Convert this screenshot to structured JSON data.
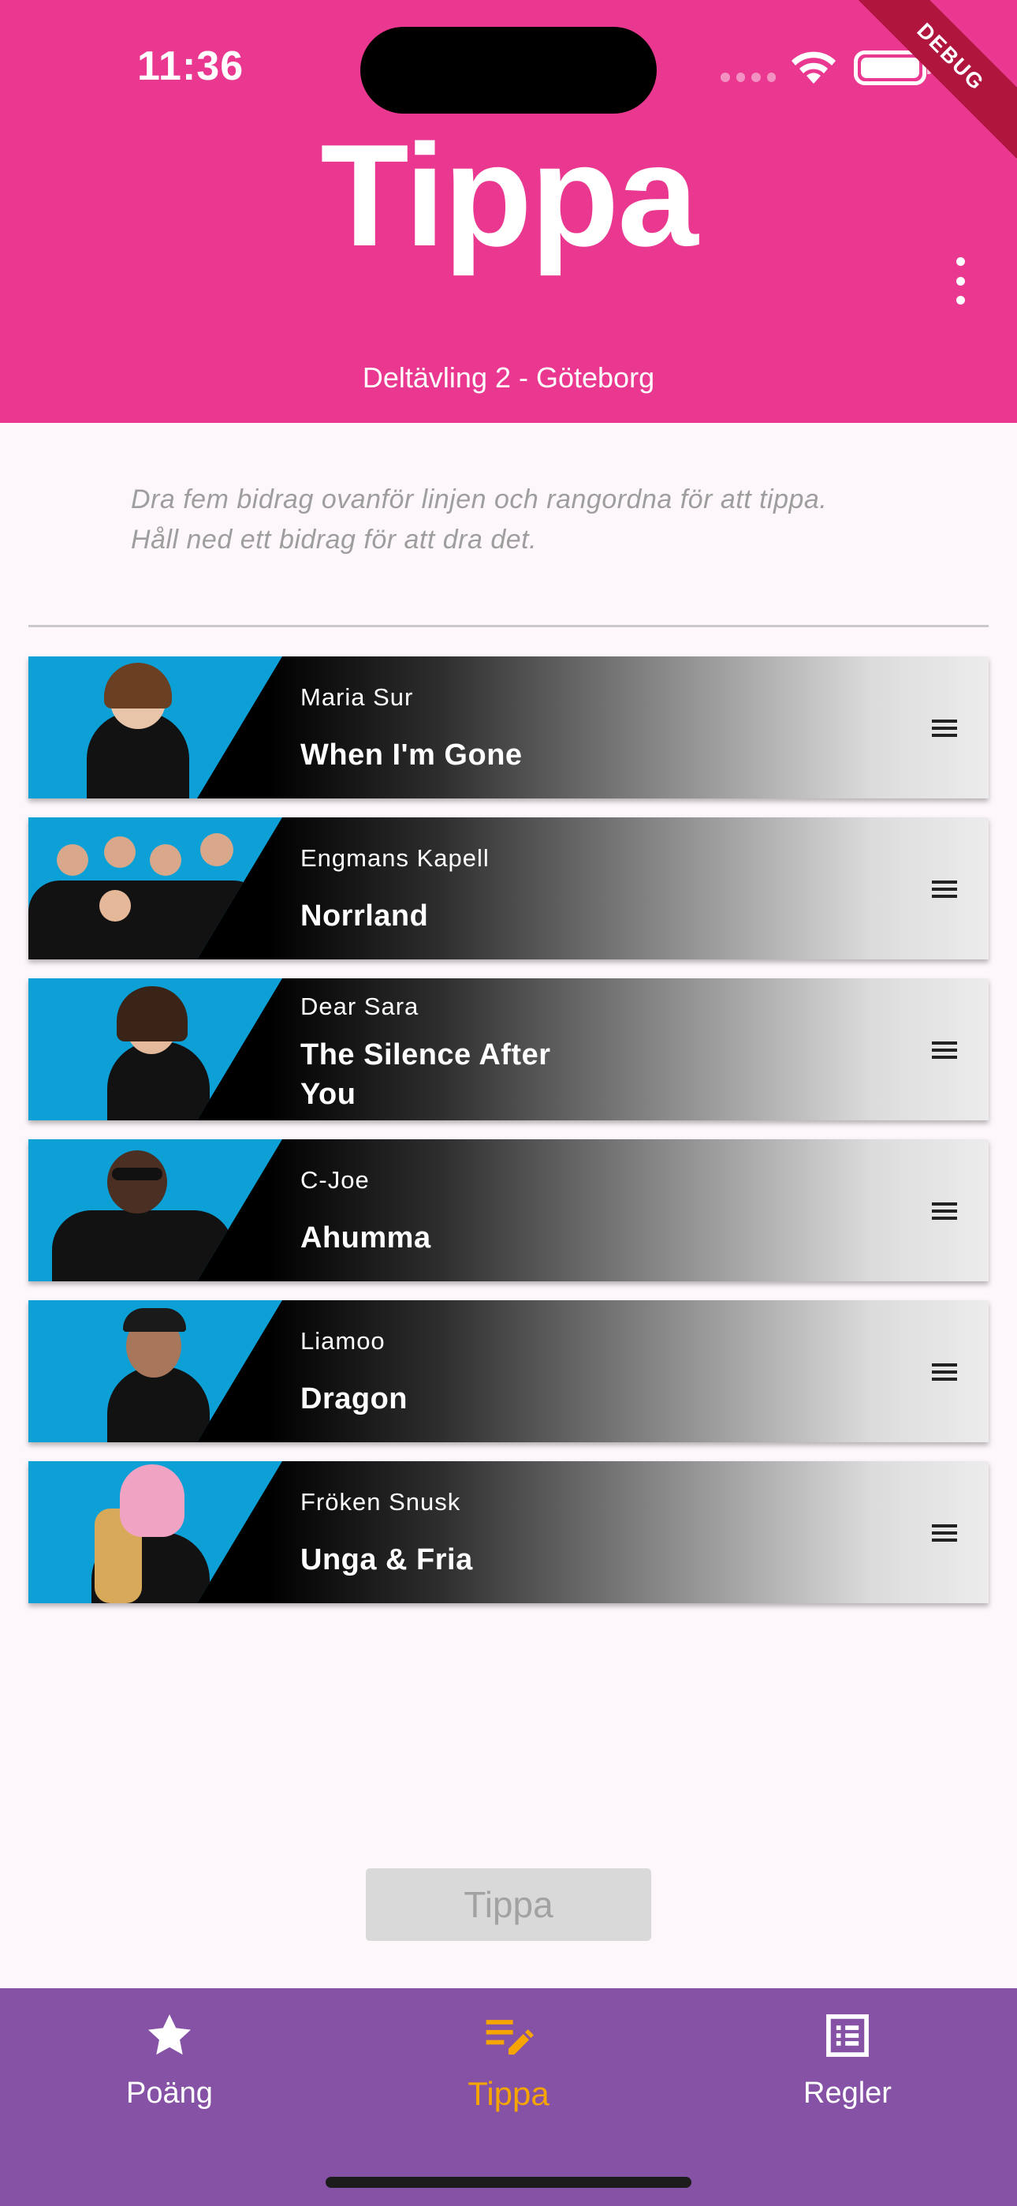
{
  "status_bar": {
    "time": "11:36",
    "debug_label": "DEBUG"
  },
  "header": {
    "title": "Tippa",
    "subtitle": "Deltävling 2 - Göteborg"
  },
  "instructions": {
    "line1": "Dra fem bidrag ovanför linjen och rangordna för att tippa.",
    "line2": "Håll ned ett bidrag för att dra det."
  },
  "entries": [
    {
      "artist": "Maria Sur",
      "song": "When I'm Gone"
    },
    {
      "artist": "Engmans Kapell",
      "song": "Norrland"
    },
    {
      "artist": "Dear Sara",
      "song": "The Silence After You"
    },
    {
      "artist": "C-Joe",
      "song": "Ahumma"
    },
    {
      "artist": "Liamoo",
      "song": "Dragon"
    },
    {
      "artist": "Fröken Snusk",
      "song": "Unga & Fria"
    }
  ],
  "submit_button": {
    "label": "Tippa",
    "enabled": false
  },
  "bottom_nav": {
    "items": [
      {
        "label": "Poäng",
        "icon": "star-icon",
        "active": false
      },
      {
        "label": "Tippa",
        "icon": "edit-list-icon",
        "active": true
      },
      {
        "label": "Regler",
        "icon": "list-alt-icon",
        "active": false
      }
    ]
  },
  "colors": {
    "header": "#ea3890",
    "nav": "#8552a6",
    "active": "#f5a400",
    "photo_bg": "#0ca0d6"
  }
}
